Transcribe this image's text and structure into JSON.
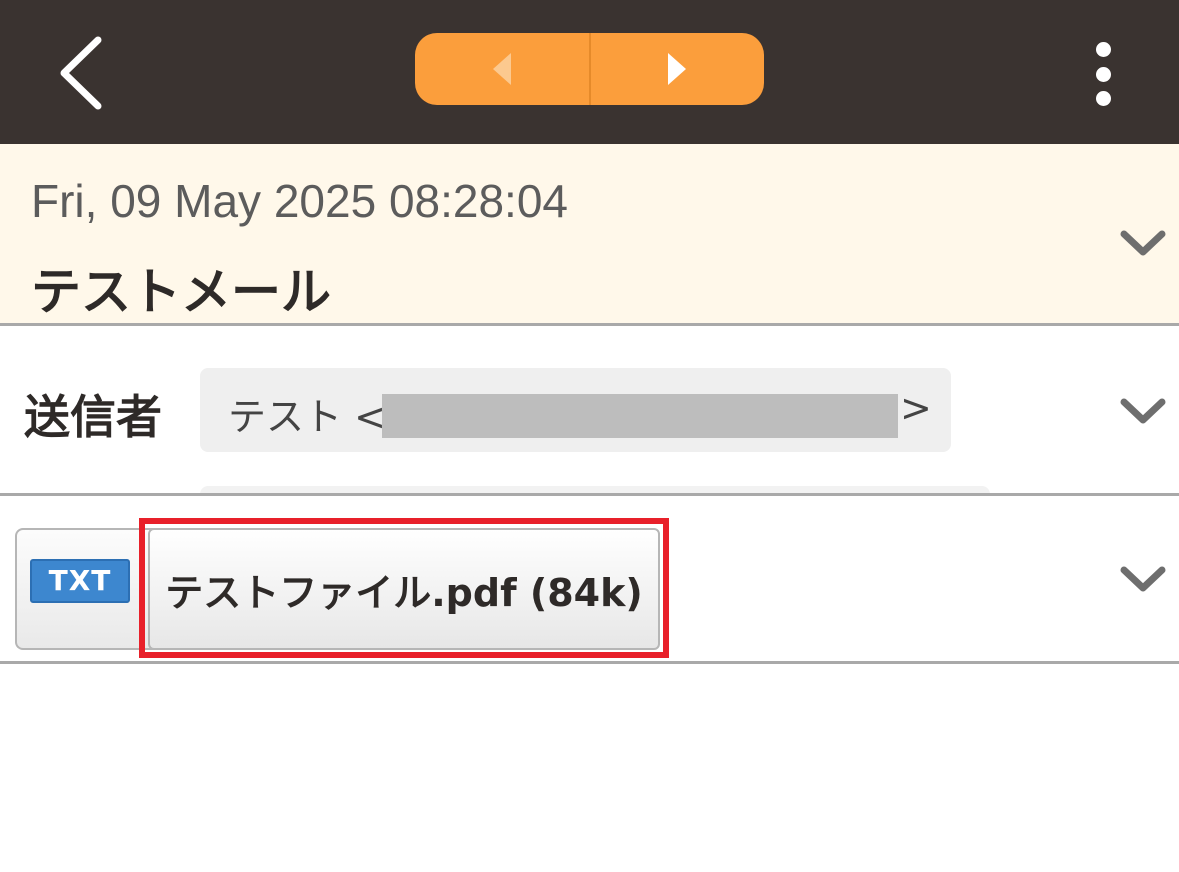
{
  "header": {
    "back_icon": "chevron-left-icon",
    "prev_icon": "triangle-left-icon",
    "next_icon": "triangle-right-icon",
    "menu_icon": "vertical-ellipsis-icon"
  },
  "message": {
    "date": "Fri, 09 May 2025 08:28:04",
    "subject": "テストメール"
  },
  "sender": {
    "label": "送信者",
    "name_prefix": "テスト <",
    "name_suffix": ">",
    "redacted": true
  },
  "attachment": {
    "type_badge": "TXT",
    "filename": "テストファイル.pdf (84k)"
  },
  "colors": {
    "topbar": "#3a3330",
    "nav_pill": "#fb9e3c",
    "subject_bg": "#fff8ea",
    "highlight": "#e8202a",
    "badge": "#3d87cf"
  }
}
